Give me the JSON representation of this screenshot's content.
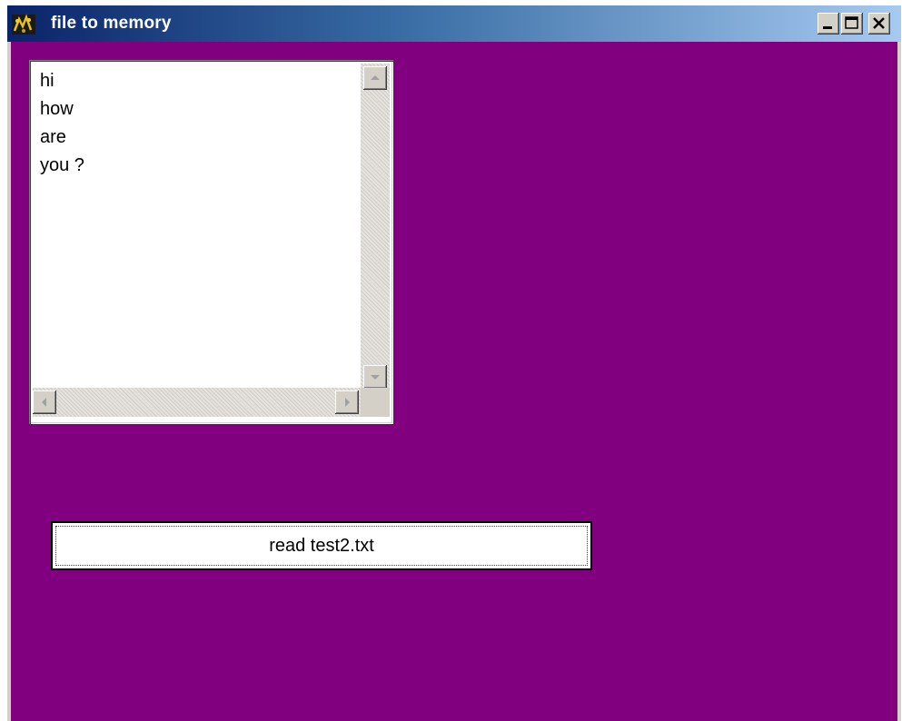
{
  "window": {
    "title": "file to memory",
    "icon": "app-icon",
    "controls": [
      "minimize-icon",
      "maximize-icon",
      "close-icon"
    ]
  },
  "colors": {
    "client_background": "#800080",
    "titlebar_start": "#0a246a",
    "titlebar_end": "#a6caf0"
  },
  "listbox": {
    "lines": [
      "hi",
      "how",
      "are",
      "you ?"
    ]
  },
  "read_button": {
    "label": "read test2.txt"
  }
}
